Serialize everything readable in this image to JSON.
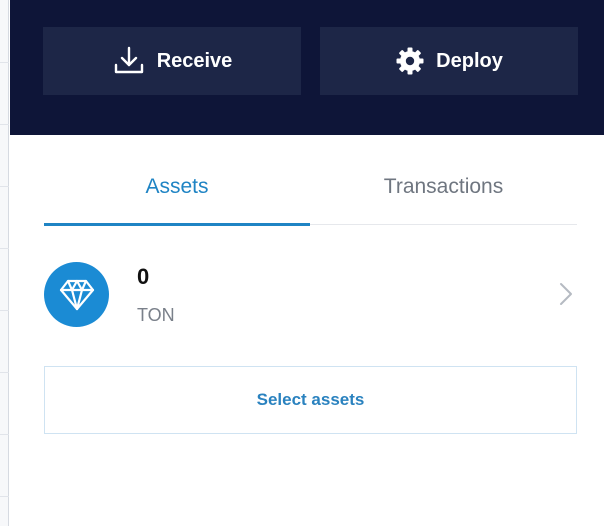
{
  "header": {
    "receive_label": "Receive",
    "receive_icon": "download-icon",
    "deploy_label": "Deploy",
    "deploy_icon": "gear-icon",
    "background_color": "#0e1538",
    "button_color": "#1d2647"
  },
  "tabs": [
    {
      "label": "Assets",
      "active": true
    },
    {
      "label": "Transactions",
      "active": false
    }
  ],
  "assets": [
    {
      "amount": "0",
      "symbol": "TON",
      "icon": "ton-diamond-icon",
      "icon_color": "#1b8bd4"
    }
  ],
  "select_assets_label": "Select assets",
  "accent_color": "#1f84c4"
}
